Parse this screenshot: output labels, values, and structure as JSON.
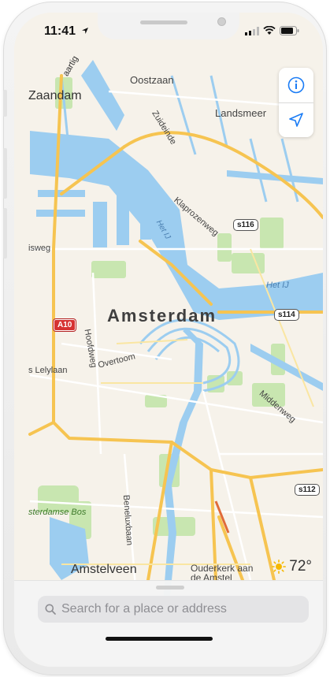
{
  "status_bar": {
    "time": "11:41"
  },
  "map": {
    "city_label": "Amsterdam",
    "towns": {
      "zaandam": "Zaandam",
      "oostzaan": "Oostzaan",
      "landsmeer": "Landsmeer",
      "amstelveen": "Amstelveen",
      "ouderkerk_line1": "Ouderkerk aan",
      "ouderkerk_line2": "de Amstel"
    },
    "streets": {
      "zuideinde": "Zuideinde",
      "klaprozenweg": "Klaprozenweg",
      "hoofdweg": "Hoofdweg",
      "overtoom": "Overtoom",
      "lelylaan": "s Lelylaan",
      "middenweg": "Middenweg",
      "beneluxbaan": "Beneluxbaan",
      "isweg": "isweg",
      "top_fragment": "aartig",
      "bos": "sterdamse Bos"
    },
    "water": {
      "het_ij_west": "Het IJ",
      "het_ij_east": "Het IJ"
    },
    "shields": {
      "s116": "s116",
      "s114": "s114",
      "s112": "s112",
      "a10": "A10"
    },
    "colors": {
      "water": "#9ccdf0",
      "land": "#f6f2ea",
      "park": "#c8e6b0",
      "highway": "#f6c451",
      "road": "#ffffff"
    }
  },
  "weather": {
    "temperature": "72°",
    "icon": "sun-icon"
  },
  "search": {
    "placeholder": "Search for a place or address"
  }
}
